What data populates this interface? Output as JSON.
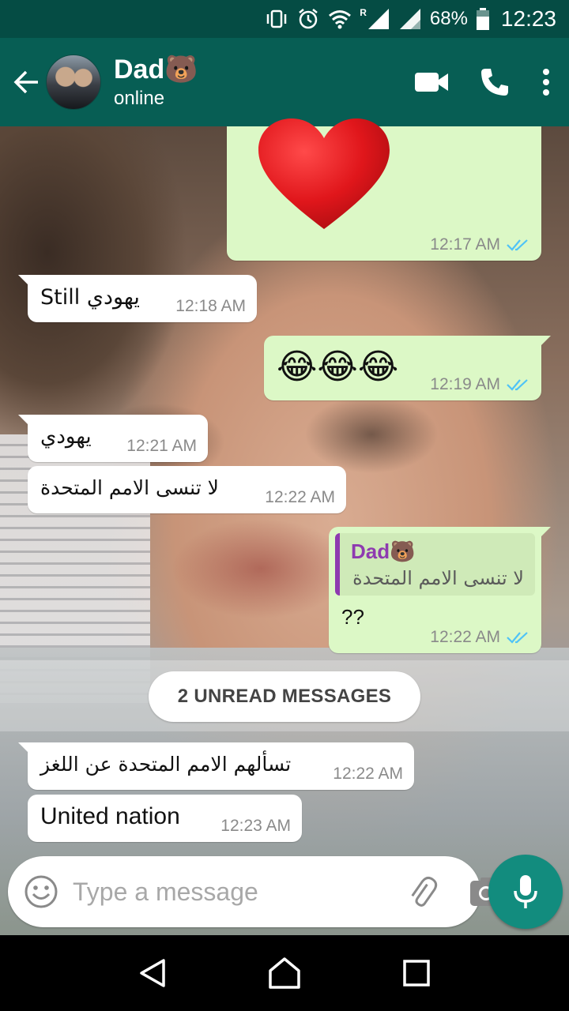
{
  "status_bar": {
    "battery_percent": "68%",
    "time": "12:23",
    "network_label": "R",
    "icons": [
      "vibrate-icon",
      "alarm-icon",
      "wifi-icon",
      "signal-icon",
      "signal-icon",
      "battery-icon"
    ]
  },
  "header": {
    "contact_name": "Dad🐻",
    "contact_status": "online",
    "icons": [
      "back-arrow-icon",
      "video-call-icon",
      "phone-icon",
      "more-vert-icon"
    ]
  },
  "messages": [
    {
      "id": "m1",
      "direction": "out",
      "content": "❤️",
      "time": "12:17 AM",
      "read": true
    },
    {
      "id": "m2",
      "direction": "in",
      "content": "Still يهودي",
      "time": "12:18 AM"
    },
    {
      "id": "m3",
      "direction": "out",
      "content": "😂😂😂",
      "time": "12:19 AM",
      "read": true
    },
    {
      "id": "m4",
      "direction": "in",
      "content": "يهودي",
      "time": "12:21 AM"
    },
    {
      "id": "m5",
      "direction": "in",
      "content": "لا تنسى الامم المتحدة",
      "time": "12:22 AM"
    },
    {
      "id": "m6",
      "direction": "out",
      "quote_name": "Dad🐻",
      "quote_text": "لا تنسى الامم المتحدة",
      "content": "??",
      "time": "12:22 AM",
      "read": true
    },
    {
      "id": "m7",
      "direction": "in",
      "content": "تسألهم الامم المتحدة عن اللغز",
      "time": "12:22 AM"
    },
    {
      "id": "m8",
      "direction": "in",
      "content": "United nation",
      "time": "12:23 AM"
    }
  ],
  "unread_banner": "2 UNREAD MESSAGES",
  "composer": {
    "placeholder": "Type a message",
    "icons": [
      "emoji-icon",
      "attach-icon",
      "camera-icon",
      "mic-icon"
    ]
  },
  "colors": {
    "status_bar": "#054c44",
    "app_bar": "#075e54",
    "outgoing_bubble": "#dcf8c6",
    "incoming_bubble": "#ffffff",
    "read_ticks": "#4fc3f7",
    "mic_button": "#128c7e",
    "quote_accent": "#8e3ab0"
  },
  "nav_bar": {
    "icons": [
      "back-triangle-icon",
      "home-icon",
      "recents-icon"
    ]
  }
}
